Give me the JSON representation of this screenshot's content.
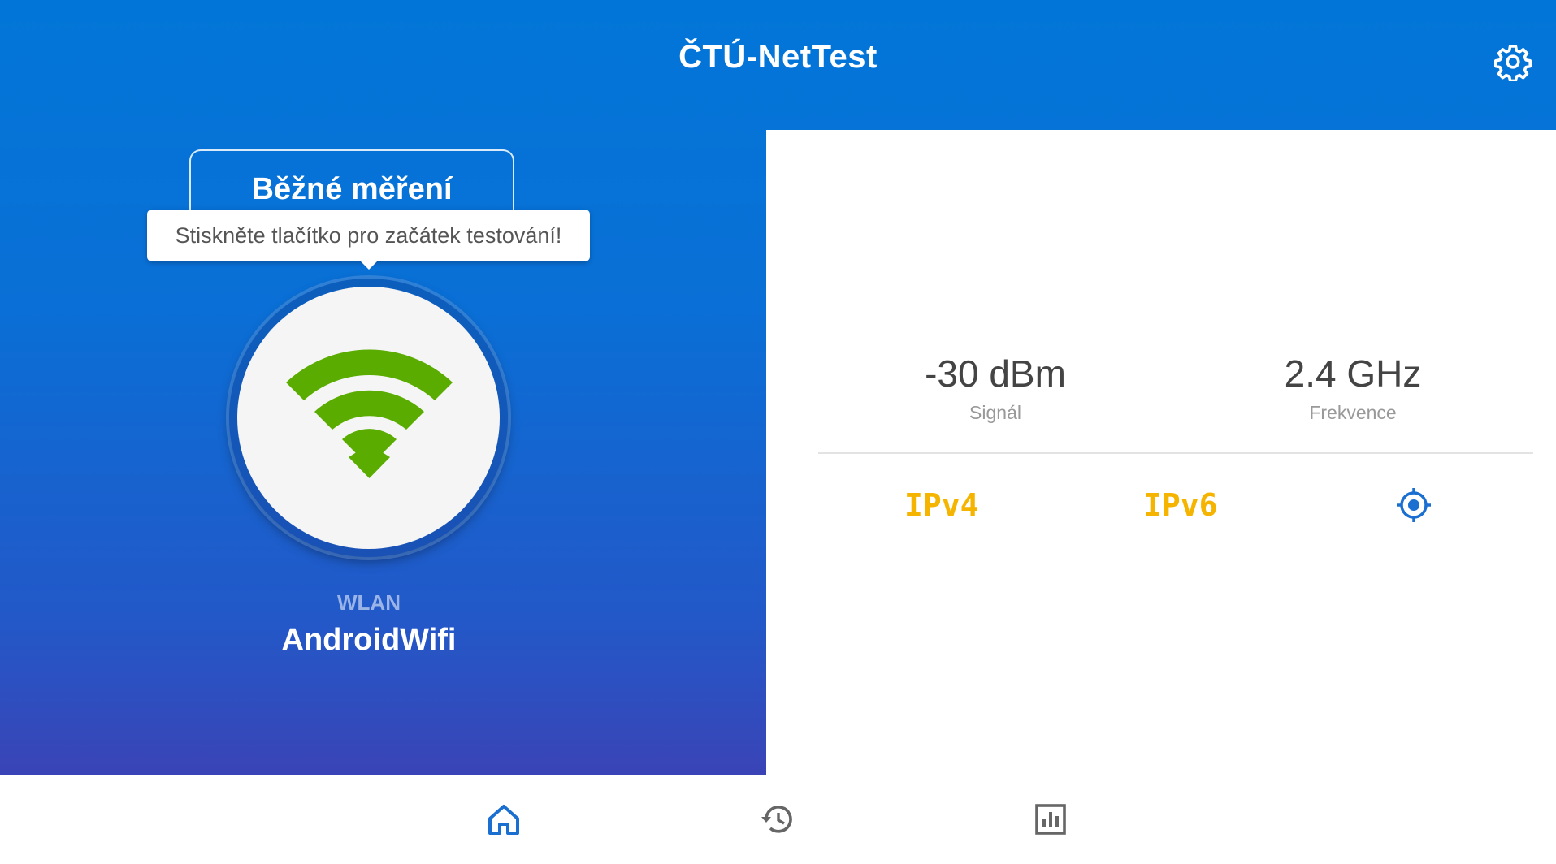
{
  "app": {
    "title": "ČTÚ-NetTest"
  },
  "test": {
    "mode_label": "Běžné měření",
    "tooltip": "Stiskněte tlačítko pro začátek testování!"
  },
  "network": {
    "type": "WLAN",
    "name": "AndroidWifi"
  },
  "stats": {
    "signal": {
      "value": "-30 dBm",
      "label": "Signál"
    },
    "frequency": {
      "value": "2.4 GHz",
      "label": "Frekvence"
    }
  },
  "indicators": {
    "ipv4": "IPv4",
    "ipv6": "IPv6",
    "location_icon": "gps-target-icon"
  },
  "nav": [
    {
      "icon": "home-icon",
      "active": true
    },
    {
      "icon": "history-icon",
      "active": false
    },
    {
      "icon": "statistics-icon",
      "active": false
    }
  ],
  "colors": {
    "primary": "#0276d8",
    "wifi_green": "#5aac00",
    "ip_yellow": "#f5b400",
    "accent_blue": "#1a6fd0"
  }
}
